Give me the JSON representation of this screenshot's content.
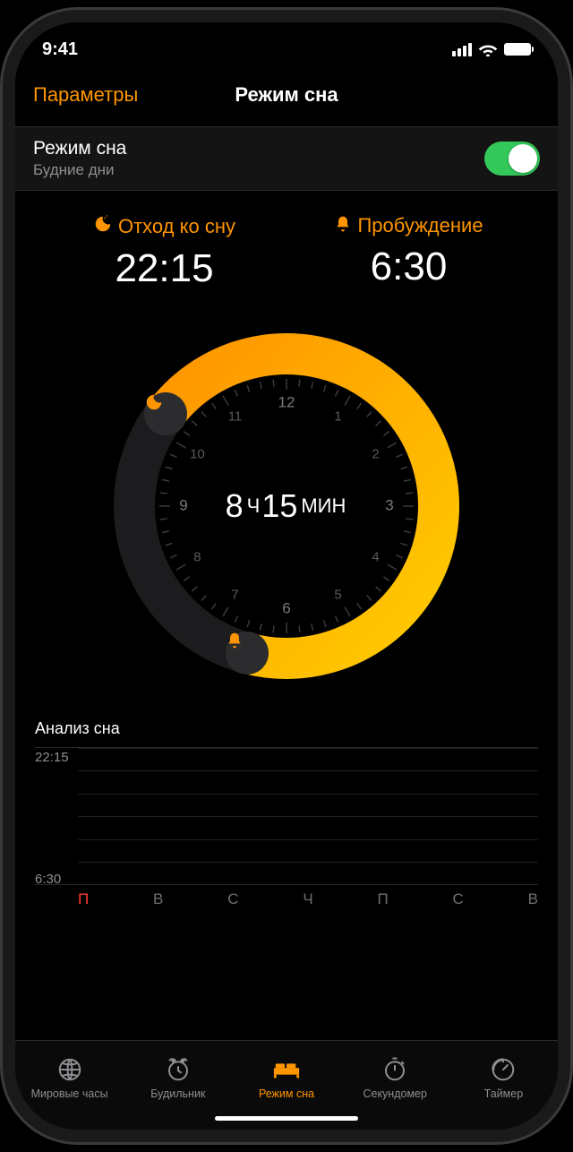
{
  "status": {
    "time": "9:41"
  },
  "nav": {
    "back": "Параметры",
    "title": "Режим сна"
  },
  "toggle": {
    "title": "Режим сна",
    "subtitle": "Будние дни",
    "on": true
  },
  "bedtime": {
    "label": "Отход ко сну",
    "value": "22:15"
  },
  "wake": {
    "label": "Пробуждение",
    "value": "6:30"
  },
  "duration": {
    "hours": "8",
    "hours_unit": "Ч",
    "mins": "15",
    "mins_unit": "МИН"
  },
  "clock_numbers": [
    "12",
    "1",
    "2",
    "3",
    "4",
    "5",
    "6",
    "7",
    "8",
    "9",
    "10",
    "11"
  ],
  "arc": {
    "start_deg": 307.5,
    "end_deg": 195
  },
  "analysis": {
    "title": "Анализ сна",
    "top_time": "22:15",
    "bottom_time": "6:30",
    "days": [
      "П",
      "В",
      "С",
      "Ч",
      "П",
      "С",
      "В"
    ]
  },
  "tabs": [
    {
      "id": "world",
      "label": "Мировые часы"
    },
    {
      "id": "alarm",
      "label": "Будильник"
    },
    {
      "id": "bedtime",
      "label": "Режим сна",
      "active": true
    },
    {
      "id": "stopwatch",
      "label": "Секундомер"
    },
    {
      "id": "timer",
      "label": "Таймер"
    }
  ],
  "colors": {
    "accent": "#ff9500",
    "green": "#34c759",
    "red": "#ff3b30"
  }
}
